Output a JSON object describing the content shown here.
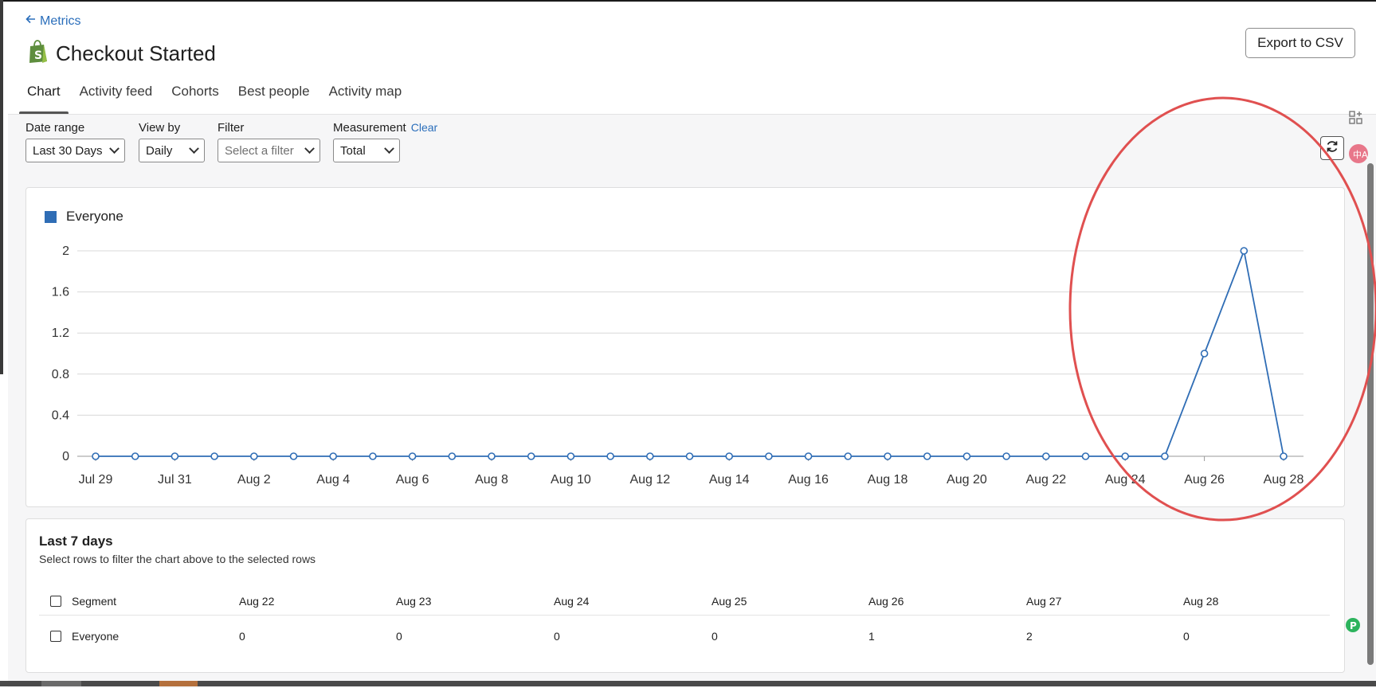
{
  "nav": {
    "back_label": "Metrics"
  },
  "header": {
    "title": "Checkout Started",
    "export_label": "Export to CSV"
  },
  "tabs": [
    {
      "label": "Chart",
      "active": true
    },
    {
      "label": "Activity feed"
    },
    {
      "label": "Cohorts"
    },
    {
      "label": "Best people"
    },
    {
      "label": "Activity map"
    }
  ],
  "controls": {
    "date_range": {
      "label": "Date range",
      "value": "Last 30 Days"
    },
    "view_by": {
      "label": "View by",
      "value": "Daily"
    },
    "filter": {
      "label": "Filter",
      "placeholder": "Select a filter"
    },
    "measurement": {
      "label": "Measurement",
      "clear": "Clear",
      "value": "Total"
    }
  },
  "colors": {
    "series": "#2f6db5",
    "accent_link": "#2a6ebb",
    "annotation": "#e05050"
  },
  "chart_data": {
    "type": "line",
    "legend": "top-left",
    "grid": true,
    "series": [
      {
        "name": "Everyone",
        "values": [
          0,
          0,
          0,
          0,
          0,
          0,
          0,
          0,
          0,
          0,
          0,
          0,
          0,
          0,
          0,
          0,
          0,
          0,
          0,
          0,
          0,
          0,
          0,
          0,
          0,
          0,
          0,
          0,
          1,
          2,
          0
        ]
      }
    ],
    "x_tick_labels": [
      "Jul 29",
      "Jul 31",
      "Aug 2",
      "Aug 4",
      "Aug 6",
      "Aug 8",
      "Aug 10",
      "Aug 12",
      "Aug 14",
      "Aug 16",
      "Aug 18",
      "Aug 20",
      "Aug 22",
      "Aug 24",
      "Aug 26",
      "Aug 28"
    ],
    "y_ticks": [
      "0",
      "0.4",
      "0.8",
      "1.2",
      "1.6",
      "2"
    ],
    "ylim": [
      0,
      2
    ]
  },
  "table": {
    "title": "Last 7 days",
    "subtitle": "Select rows to filter the chart above to the selected rows",
    "segment_header": "Segment",
    "columns": [
      "Aug 22",
      "Aug 23",
      "Aug 24",
      "Aug 25",
      "Aug 26",
      "Aug 27",
      "Aug 28"
    ],
    "rows": [
      {
        "segment": "Everyone",
        "values": [
          "0",
          "0",
          "0",
          "0",
          "1",
          "2",
          "0"
        ]
      }
    ]
  }
}
